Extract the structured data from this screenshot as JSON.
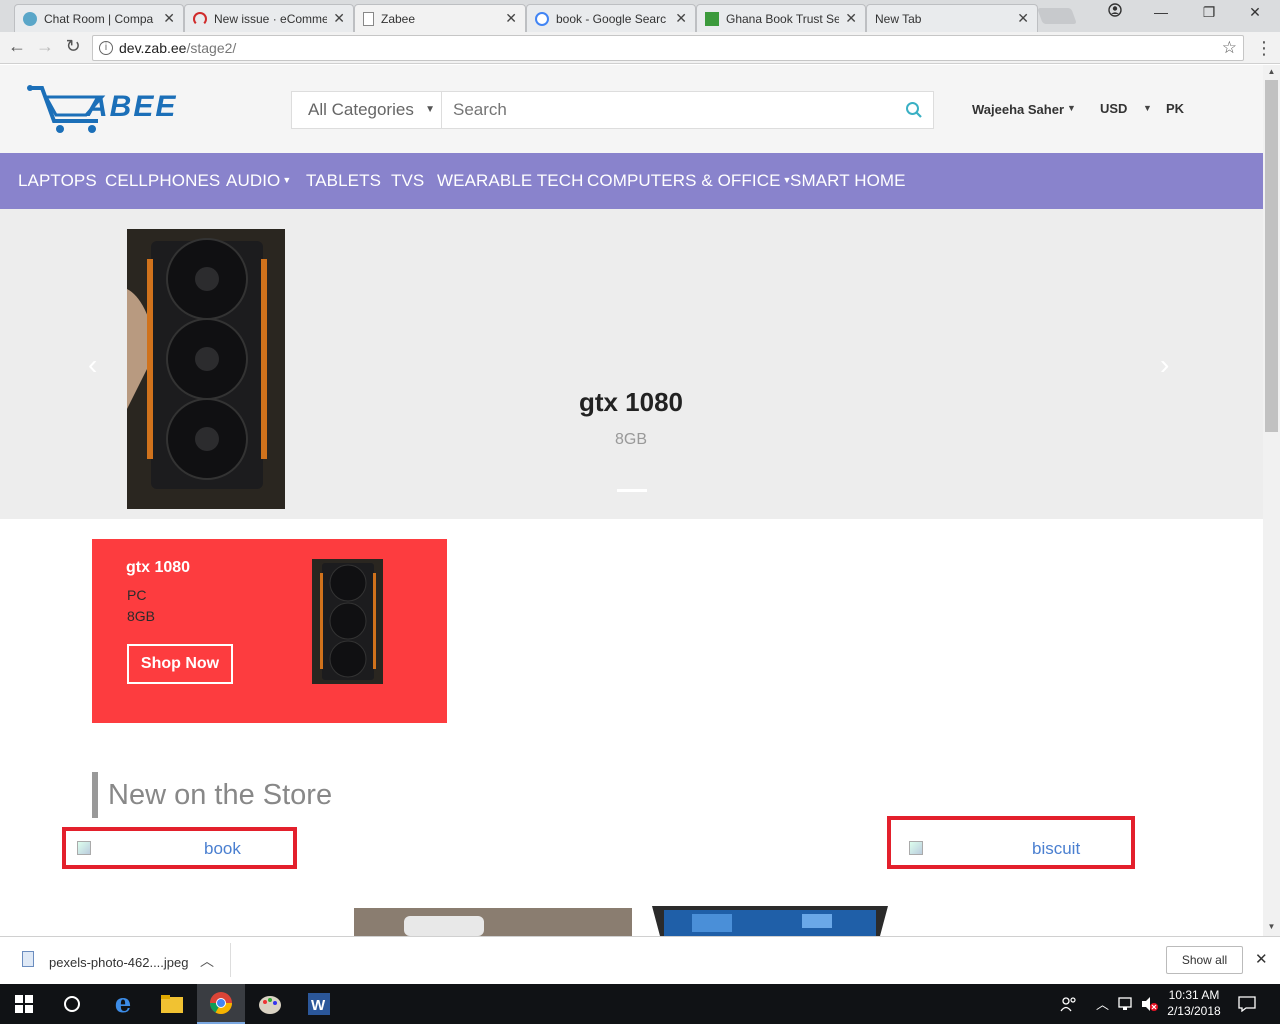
{
  "browser": {
    "tabs": [
      {
        "title": "Chat Room | Compa",
        "favicon_color": "#5aa6c8"
      },
      {
        "title": "New issue · eComme",
        "favicon_color": "#d02b2b"
      },
      {
        "title": "Zabee",
        "favicon_color": "#ffffff"
      },
      {
        "title": "book - Google Searc",
        "favicon_color": "#4285f4"
      },
      {
        "title": "Ghana Book Trust Se",
        "favicon_color": "#3c9a3c"
      },
      {
        "title": "New Tab",
        "favicon_color": "#e9ebed"
      }
    ],
    "address": {
      "host": "dev.zab.ee",
      "path": "/stage2/"
    }
  },
  "header": {
    "category_select": "All Categories",
    "search_placeholder": "Search",
    "user": "Wajeeha Saher",
    "currency": "USD",
    "country": "PK"
  },
  "nav": {
    "items": [
      {
        "label": "LAPTOPS",
        "dropdown": false
      },
      {
        "label": "CELLPHONES",
        "dropdown": false
      },
      {
        "label": "AUDIO",
        "dropdown": true
      },
      {
        "label": "TABLETS",
        "dropdown": false
      },
      {
        "label": "TVS",
        "dropdown": false
      },
      {
        "label": "WEARABLE TECH",
        "dropdown": false
      },
      {
        "label": "COMPUTERS & OFFICE",
        "dropdown": true
      },
      {
        "label": "SMART HOME",
        "dropdown": false
      }
    ],
    "background": "#8983cc"
  },
  "hero": {
    "title": "gtx 1080",
    "subtitle": "8GB"
  },
  "promo": {
    "title": "gtx 1080",
    "line1": "PC",
    "line2": "8GB",
    "button": "Shop Now",
    "background": "#fd3c3f"
  },
  "section": {
    "title": "New on the Store"
  },
  "products": [
    {
      "alt": "book"
    },
    {
      "alt": "biscuit"
    }
  ],
  "download": {
    "filename": "pexels-photo-462....jpeg",
    "show_all": "Show all"
  },
  "taskbar": {
    "time": "10:31 AM",
    "date": "2/13/2018"
  }
}
